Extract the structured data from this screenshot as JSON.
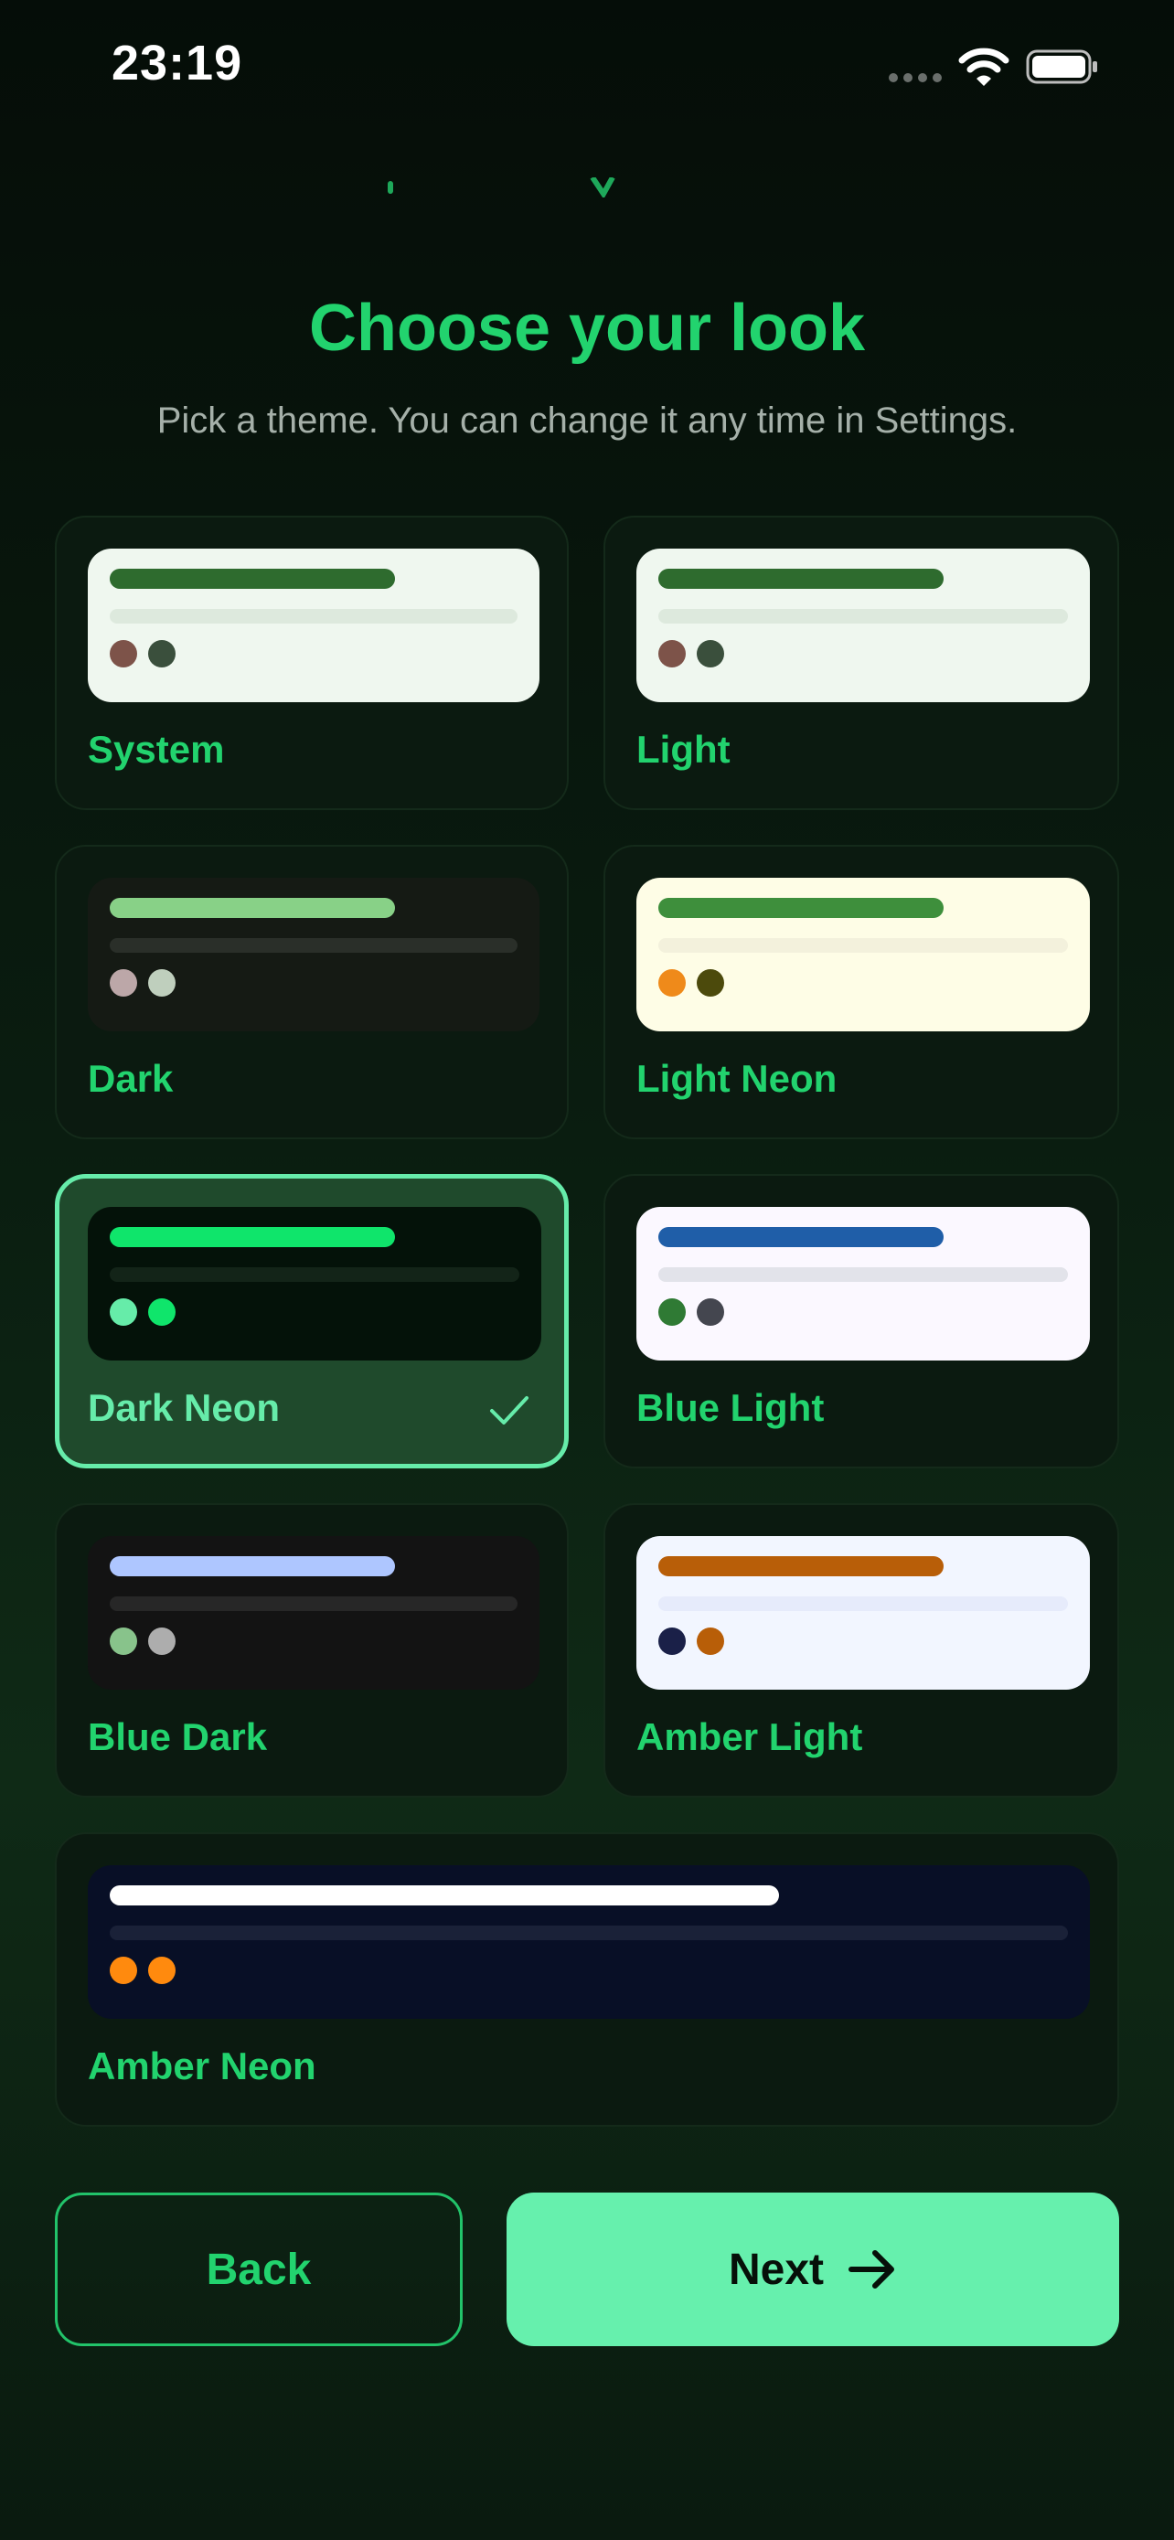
{
  "status_bar": {
    "time": "23:19"
  },
  "header": {
    "title": "Choose your look",
    "subtitle": "Pick a theme. You can change it any time in Settings."
  },
  "themes": [
    {
      "label": "System",
      "selected": false,
      "colors": {
        "preview_bg": "#eff7ef",
        "bar_primary": "#2e6b2e",
        "bar_secondary": "#dde9dd",
        "dot1": "#7d5349",
        "dot2": "#3a4f3c"
      }
    },
    {
      "label": "Light",
      "selected": false,
      "colors": {
        "preview_bg": "#eff7ef",
        "bar_primary": "#2e6b2e",
        "bar_secondary": "#dde9dd",
        "dot1": "#7d5349",
        "dot2": "#3a4f3c"
      }
    },
    {
      "label": "Dark",
      "selected": false,
      "colors": {
        "preview_bg": "#151a14",
        "bar_primary": "#88d187",
        "bar_secondary": "#2a2f29",
        "dot1": "#bca7a8",
        "dot2": "#bfcfbd"
      }
    },
    {
      "label": "Light Neon",
      "selected": false,
      "colors": {
        "preview_bg": "#fefde6",
        "bar_primary": "#3e8f3c",
        "bar_secondary": "#f3f1dc",
        "dot1": "#ef8a1a",
        "dot2": "#4c4a0c"
      }
    },
    {
      "label": "Dark Neon",
      "selected": true,
      "colors": {
        "preview_bg": "#041209",
        "bar_primary": "#0fe56b",
        "bar_secondary": "#132418",
        "dot1": "#66eca9",
        "dot2": "#0fe56b"
      }
    },
    {
      "label": "Blue Light",
      "selected": false,
      "colors": {
        "preview_bg": "#fbf8ff",
        "bar_primary": "#1f5ea8",
        "bar_secondary": "#e2e3ea",
        "dot1": "#2f7a34",
        "dot2": "#44464f"
      }
    },
    {
      "label": "Blue Dark",
      "selected": false,
      "colors": {
        "preview_bg": "#131313",
        "bar_primary": "#aec6ff",
        "bar_secondary": "#272727",
        "dot1": "#88c38b",
        "dot2": "#adadad"
      }
    },
    {
      "label": "Amber Light",
      "selected": false,
      "colors": {
        "preview_bg": "#f2f6ff",
        "bar_primary": "#b85e08",
        "bar_secondary": "#e6ebfb",
        "dot1": "#1a2048",
        "dot2": "#b85e08"
      }
    },
    {
      "label": "Amber Neon",
      "selected": false,
      "colors": {
        "preview_bg": "#080f26",
        "bar_primary": "#ffffff",
        "bar_secondary": "#1a2138",
        "dot1": "#ff8a0e",
        "dot2": "#ff8a0e"
      }
    }
  ],
  "buttons": {
    "back": "Back",
    "next": "Next"
  },
  "icons": {
    "check": "checkmark-icon",
    "next": "arrow-right-icon",
    "wifi": "wifi-icon",
    "battery": "battery-icon"
  },
  "accent": {
    "primary": "#22d36e",
    "selected": "#66ecaa",
    "next_button": "#66f0ad"
  }
}
